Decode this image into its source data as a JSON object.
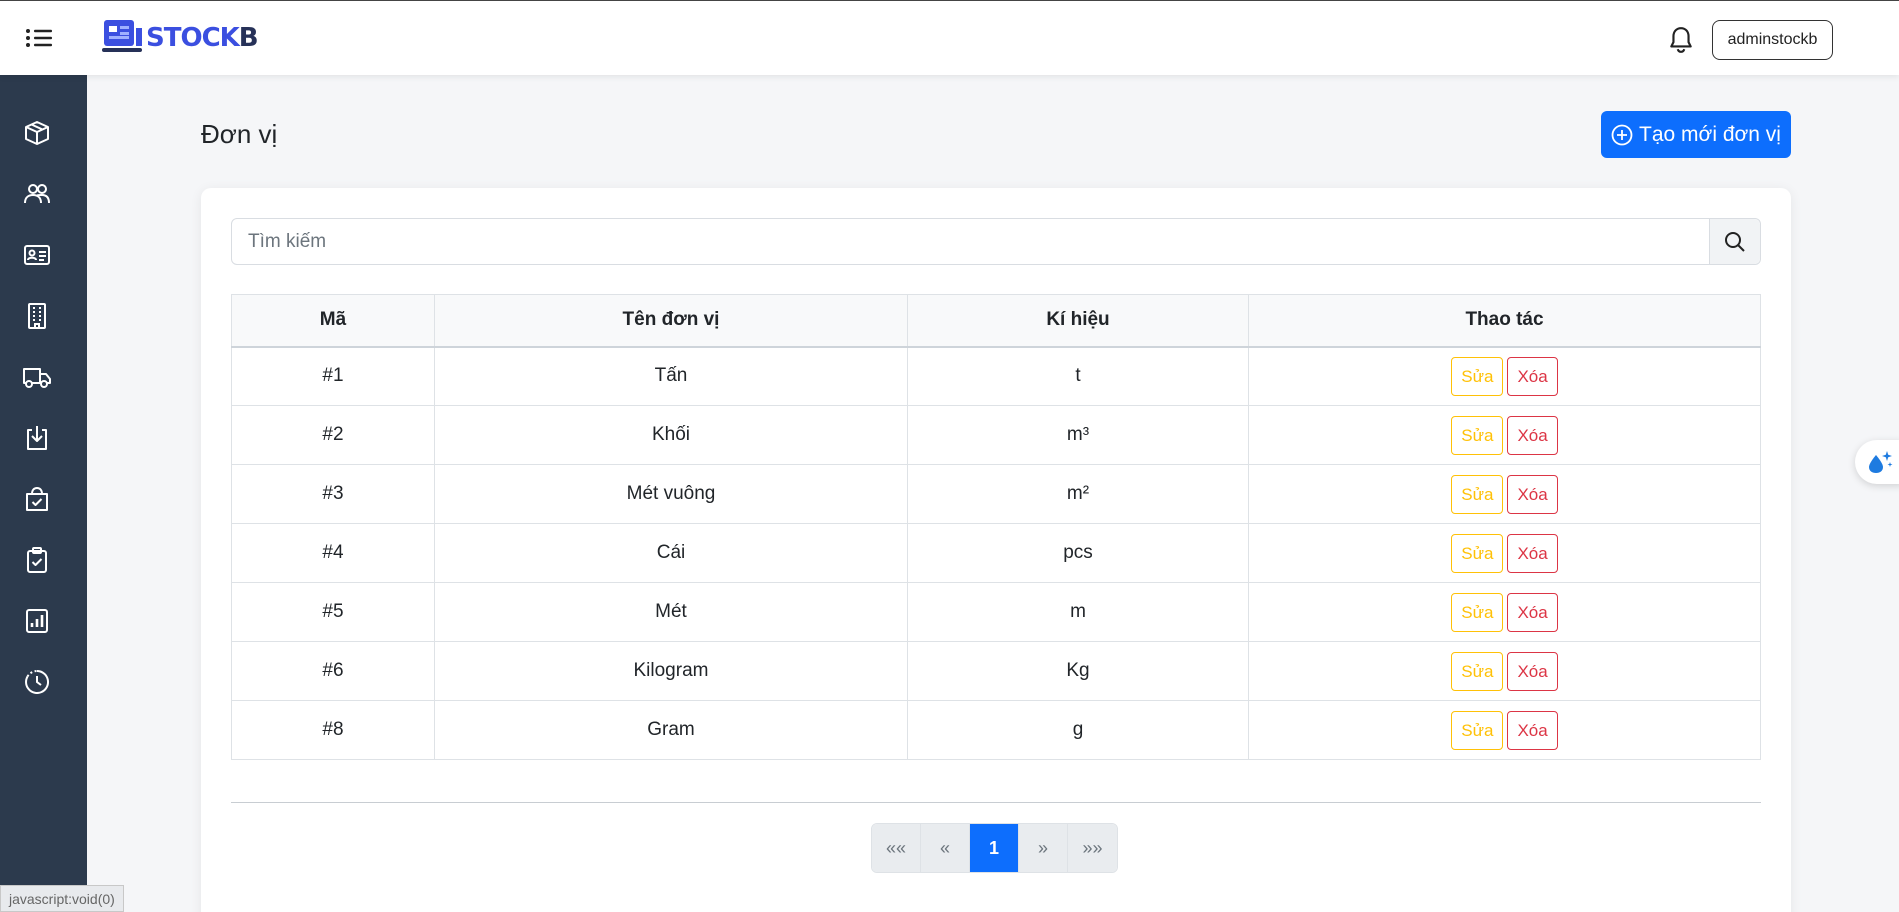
{
  "header": {
    "logo_text_main": "STOCK",
    "logo_text_end": "B",
    "menu_icon": "hamburger-list-icon",
    "bell_icon": "bell-icon",
    "user_label": "adminstockb"
  },
  "sidebar": {
    "items": [
      {
        "icon": "box-icon"
      },
      {
        "icon": "people-icon"
      },
      {
        "icon": "id-card-icon"
      },
      {
        "icon": "building-icon"
      },
      {
        "icon": "truck-icon"
      },
      {
        "icon": "box-arrow-in-icon"
      },
      {
        "icon": "bag-check-icon"
      },
      {
        "icon": "clipboard-check-icon"
      },
      {
        "icon": "bar-chart-icon"
      },
      {
        "icon": "clock-history-icon"
      }
    ]
  },
  "main": {
    "title": "Đơn vị",
    "create_button": "Tạo mới đơn vị",
    "search_placeholder": "Tìm kiếm",
    "table": {
      "headers": [
        "Mã",
        "Tên đơn vị",
        "Kí hiệu",
        "Thao tác"
      ],
      "rows": [
        {
          "id": "#1",
          "name": "Tấn",
          "symbol": "t"
        },
        {
          "id": "#2",
          "name": "Khối",
          "symbol": "m³"
        },
        {
          "id": "#3",
          "name": "Mét vuông",
          "symbol": "m²"
        },
        {
          "id": "#4",
          "name": "Cái",
          "symbol": "pcs"
        },
        {
          "id": "#5",
          "name": "Mét",
          "symbol": "m"
        },
        {
          "id": "#6",
          "name": "Kilogram",
          "symbol": "Kg"
        },
        {
          "id": "#8",
          "name": "Gram",
          "symbol": "g"
        }
      ],
      "edit_label": "Sửa",
      "delete_label": "Xóa"
    },
    "pagination": {
      "first": "««",
      "prev": "«",
      "current": "1",
      "next": "»",
      "last": "»»"
    }
  },
  "status_bar": "javascript:void(0)",
  "colors": {
    "primary": "#0d6efd",
    "sidebar": "#2c3a4d",
    "warning": "#ffc107",
    "danger": "#dc3545"
  }
}
